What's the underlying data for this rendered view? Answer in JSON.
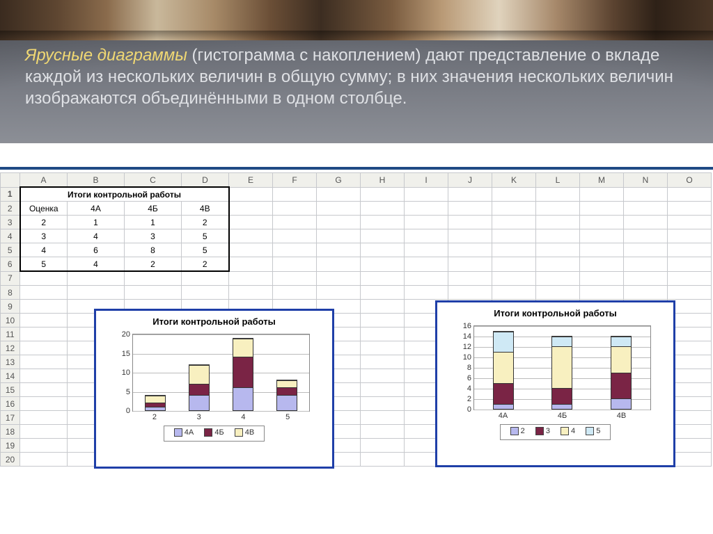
{
  "hero": {
    "emph": "Ярусные диаграммы",
    "rest": " (гистограмма с накоплением) дают представление о вкладе каждой из нескольких величин в общую сумму; в них значения нескольких величин изображаются объединёнными в одном столбце."
  },
  "columns": [
    "A",
    "B",
    "C",
    "D",
    "E",
    "F",
    "G",
    "H",
    "I",
    "J",
    "K",
    "L",
    "M",
    "N",
    "O"
  ],
  "row_numbers": [
    "1",
    "2",
    "3",
    "4",
    "5",
    "6",
    "7",
    "8",
    "9",
    "10",
    "11",
    "12",
    "13",
    "14",
    "15",
    "16",
    "17",
    "18",
    "19",
    "20"
  ],
  "table": {
    "title": "Итоги контрольной работы",
    "header": [
      "Оценка",
      "4А",
      "4Б",
      "4В"
    ],
    "rows": [
      [
        "2",
        "1",
        "1",
        "2"
      ],
      [
        "3",
        "4",
        "3",
        "5"
      ],
      [
        "4",
        "6",
        "8",
        "5"
      ],
      [
        "5",
        "4",
        "2",
        "2"
      ]
    ]
  },
  "chart1_title": "Итоги контрольной работы",
  "chart2_title": "Итоги контрольной работы",
  "legend1": {
    "a": "4А",
    "b": "4Б",
    "c": "4В"
  },
  "legend2": {
    "a": "2",
    "b": "3",
    "c": "4",
    "d": "5"
  },
  "ylabels1": [
    "0",
    "5",
    "10",
    "15",
    "20"
  ],
  "xlabels1": [
    "2",
    "3",
    "4",
    "5"
  ],
  "ylabels2": [
    "0",
    "2",
    "4",
    "6",
    "8",
    "10",
    "12",
    "14",
    "16"
  ],
  "xlabels2": [
    "4А",
    "4Б",
    "4В"
  ],
  "chart_data": [
    {
      "type": "bar_stacked",
      "title": "Итоги контрольной работы",
      "xlabel": "",
      "ylabel": "",
      "ylim": [
        0,
        20
      ],
      "categories": [
        "2",
        "3",
        "4",
        "5"
      ],
      "series": [
        {
          "name": "4А",
          "values": [
            1,
            4,
            6,
            4
          ]
        },
        {
          "name": "4Б",
          "values": [
            1,
            3,
            8,
            2
          ]
        },
        {
          "name": "4В",
          "values": [
            2,
            5,
            5,
            2
          ]
        }
      ],
      "stack_totals": [
        4,
        12,
        19,
        8
      ]
    },
    {
      "type": "bar_stacked",
      "title": "Итоги контрольной работы",
      "xlabel": "",
      "ylabel": "",
      "ylim": [
        0,
        16
      ],
      "categories": [
        "4А",
        "4Б",
        "4В"
      ],
      "series": [
        {
          "name": "2",
          "values": [
            1,
            1,
            2
          ]
        },
        {
          "name": "3",
          "values": [
            4,
            3,
            5
          ]
        },
        {
          "name": "4",
          "values": [
            6,
            8,
            5
          ]
        },
        {
          "name": "5",
          "values": [
            4,
            2,
            2
          ]
        }
      ],
      "stack_totals": [
        15,
        14,
        14
      ]
    }
  ]
}
